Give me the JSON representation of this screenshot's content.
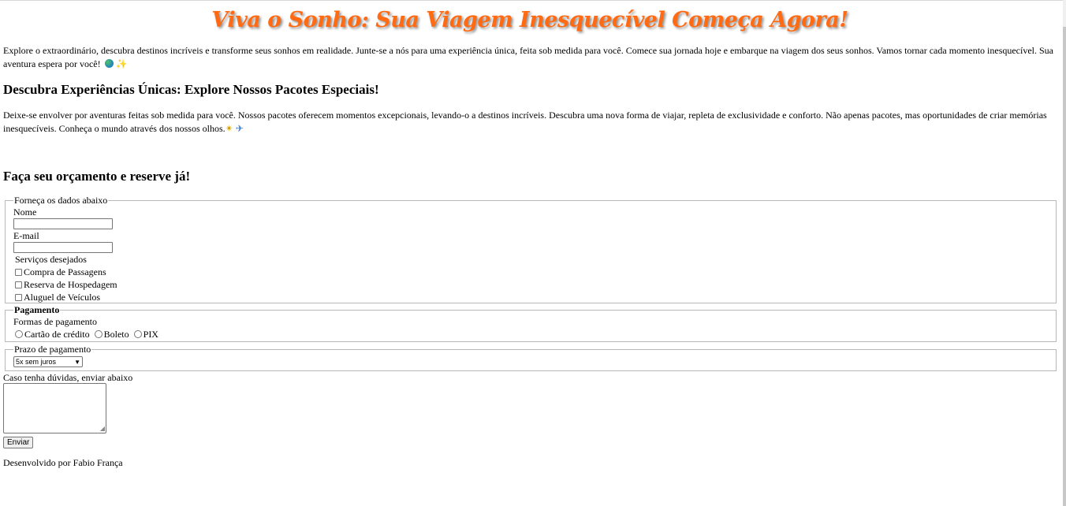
{
  "header": {
    "title": "Viva o Sonho: Sua Viagem Inesquecível Começa Agora!"
  },
  "intro": {
    "text": "Explore o extraordinário, descubra destinos incríveis e transforme seus sonhos em realidade. Junte-se a nós para uma experiência única, feita sob medida para você. Comece sua jornada hoje e embarque na viagem dos seus sonhos. Vamos tornar cada momento inesquecível. Sua aventura espera por você!",
    "icons": [
      "globe-icon",
      "sparkles-icon"
    ]
  },
  "packages": {
    "heading": "Descubra Experiências Únicas: Explore Nossos Pacotes Especiais!",
    "text": "Deixe-se envolver por aventuras feitas sob medida para você. Nossos pacotes oferecem momentos excepcionais, levando-o a destinos incríveis. Descubra uma nova forma de viajar, repleta de exclusividade e conforto. Não apenas pacotes, mas oportunidades de criar memórias inesquecíveis. Conheça o mundo através dos nossos olhos.",
    "icons": [
      "sparkle-icon",
      "airplane-icon"
    ]
  },
  "form": {
    "heading": "Faça seu orçamento e reserve já!",
    "personal": {
      "legend": "Forneça os dados abaixo",
      "name_label": "Nome",
      "name_value": "",
      "email_label": "E-mail",
      "email_value": "",
      "services_label": "Serviços desejados",
      "services": [
        {
          "label": "Compra de Passagens",
          "checked": false
        },
        {
          "label": "Reserva de Hospedagem",
          "checked": false
        },
        {
          "label": "Aluguel de Veículos",
          "checked": false
        }
      ]
    },
    "payment": {
      "legend": "Pagamento",
      "methods_label": "Formas de pagamento",
      "methods": [
        {
          "label": "Cartão de crédito",
          "selected": false
        },
        {
          "label": "Boleto",
          "selected": false
        },
        {
          "label": "PIX",
          "selected": false
        }
      ]
    },
    "term": {
      "legend": "Prazo de pagamento",
      "selected": "5x sem juros"
    },
    "doubts": {
      "label": "Caso tenha dúvidas, enviar abaixo",
      "value": ""
    },
    "submit_label": "Enviar"
  },
  "footer": {
    "text": "Desenvolvido por Fabio França"
  }
}
